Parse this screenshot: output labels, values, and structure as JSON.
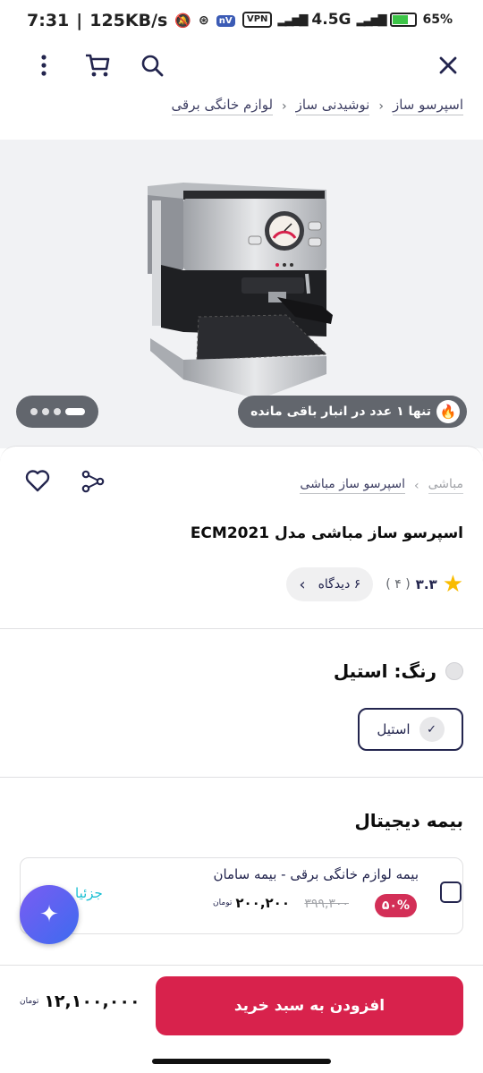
{
  "status_bar": {
    "time": "7:31",
    "speed": "125KB/s",
    "vpn": "VPN",
    "network": "4.5G",
    "battery": "65%",
    "battery_level": 0.65,
    "nv": "nV"
  },
  "toolbar": {
    "icons": [
      "more-icon",
      "cart-icon",
      "search-icon",
      "close-icon"
    ]
  },
  "breadcrumb": {
    "items": [
      "لوازم خانگی برقی",
      "نوشیدنی ساز",
      "اسپرسو ساز"
    ]
  },
  "hero": {
    "stock_text": "تنها ۱ عدد در انبار باقی مانده",
    "slide_count": 4,
    "active_slide": 4
  },
  "product": {
    "brand": "مباشی",
    "category": "اسپرسو ساز مباشی",
    "title": "اسپرسو ساز مباشی مدل ECM2021",
    "rating": "۳.۳",
    "rating_count": "( ۴ )",
    "reviews": "۶ دیدگاه"
  },
  "color": {
    "label": "رنگ: استیل",
    "option": "استیل",
    "swatch_color": "#e4e4e6"
  },
  "insurance": {
    "heading": "بیمه دیجیتال",
    "title": "بیمه لوازم خانگی برقی - بیمه سامان",
    "discount": "۵۰%",
    "old_price": "۳۹۹,۳۰۰",
    "new_price": "۲۰۰,۲۰۰",
    "currency": "تومان",
    "details": "جزئیا"
  },
  "purchase": {
    "button": "افزودن به سبد خرید",
    "price": "۱۲,۱۰۰,۰۰۰",
    "currency": "تومان"
  },
  "colors": {
    "accent": "#d8224c",
    "discount": "#d32f57",
    "link": "#19bfd3",
    "star": "#f9bc00"
  }
}
